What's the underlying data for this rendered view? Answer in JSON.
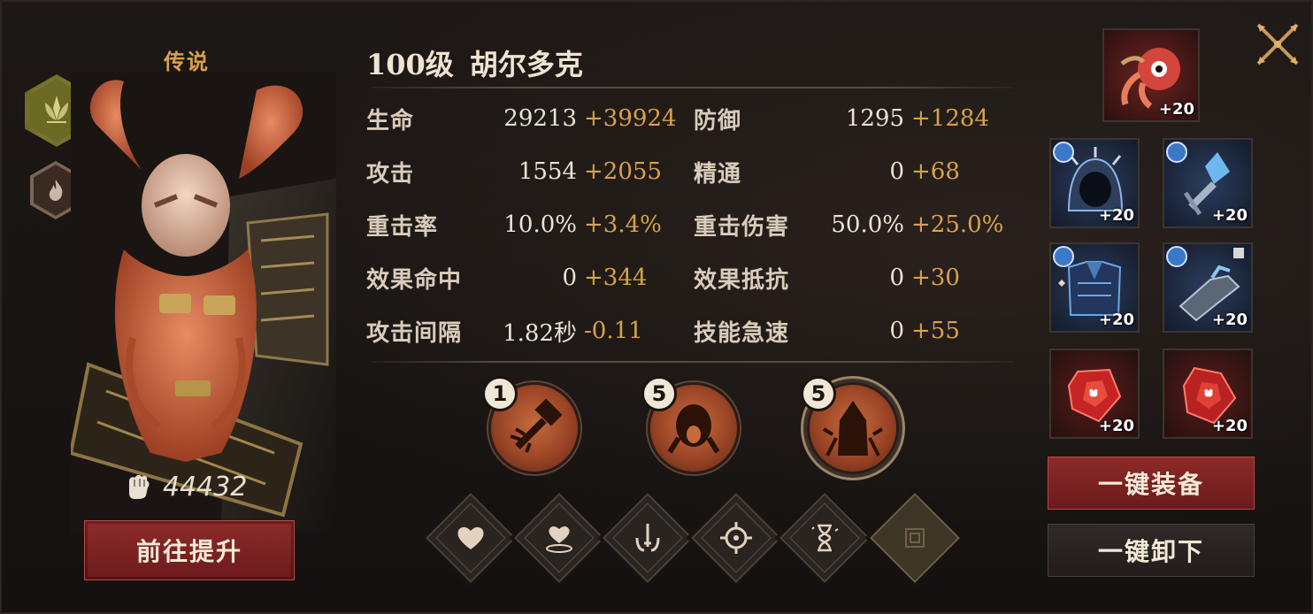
{
  "hero": {
    "rarity": "传说",
    "level": "100级",
    "name": "胡尔多克",
    "power": "44432",
    "upgrade_label": "前往提升"
  },
  "stats": {
    "left": [
      {
        "label": "生命",
        "base": "29213",
        "bonus": "+39924"
      },
      {
        "label": "攻击",
        "base": "1554",
        "bonus": "+2055"
      },
      {
        "label": "重击率",
        "base": "10.0%",
        "bonus": "+3.4%"
      },
      {
        "label": "效果命中",
        "base": "0",
        "bonus": "+344"
      },
      {
        "label": "攻击间隔",
        "base": "1.82秒",
        "bonus": "-0.11"
      }
    ],
    "right": [
      {
        "label": "防御",
        "base": "1295",
        "bonus": "+1284"
      },
      {
        "label": "精通",
        "base": "0",
        "bonus": "+68"
      },
      {
        "label": "重击伤害",
        "base": "50.0%",
        "bonus": "+25.0%"
      },
      {
        "label": "效果抵抗",
        "base": "0",
        "bonus": "+30"
      },
      {
        "label": "技能急速",
        "base": "0",
        "bonus": "+55"
      }
    ]
  },
  "skills": [
    {
      "level": "1",
      "icon": "hammer-strike-icon"
    },
    {
      "level": "5",
      "icon": "roaring-face-icon"
    },
    {
      "level": "5",
      "icon": "hooded-figure-icon"
    }
  ],
  "runes": [
    "heart-icon",
    "heart-ripple-icon",
    "sword-hands-icon",
    "crosshair-icon",
    "hourglass-icon",
    "locked-rune-icon"
  ],
  "equipment": [
    {
      "slot": "weapon",
      "level": "+20",
      "icon": "crimson-pet-icon"
    },
    {
      "slot": "helmet",
      "level": "+20",
      "icon": "hood-helmet-icon"
    },
    {
      "slot": "amulet",
      "level": "+20",
      "icon": "crystal-amulet-icon"
    },
    {
      "slot": "armor",
      "level": "+20",
      "icon": "plate-armor-icon"
    },
    {
      "slot": "gauntlet",
      "level": "+20",
      "icon": "gauntlet-icon"
    },
    {
      "slot": "gem1",
      "level": "+20",
      "icon": "red-gem-icon"
    },
    {
      "slot": "gem2",
      "level": "+20",
      "icon": "red-gem-icon"
    }
  ],
  "actions": {
    "equip_all": "一键装备",
    "unequip_all": "一键卸下"
  },
  "colors": {
    "accent_gold": "#d8a24a",
    "button_red": "#8c2a29",
    "panel_bg": "#1d1816"
  }
}
